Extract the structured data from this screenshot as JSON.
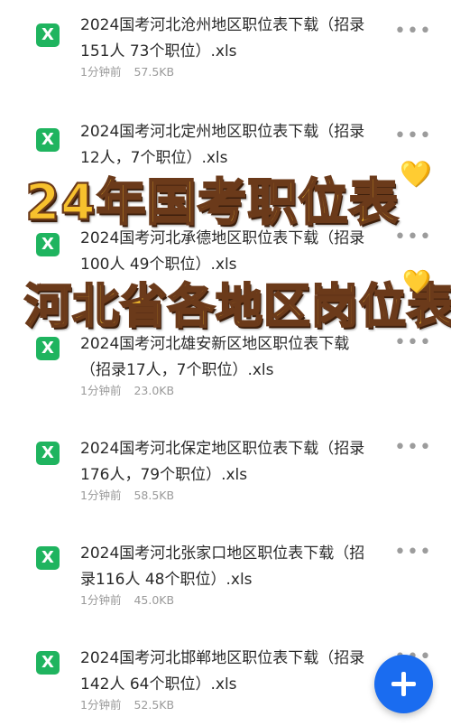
{
  "file_icon_glyph": "X",
  "more_icon_glyph": "•••",
  "colors": {
    "excel_green": "#1fb45f",
    "fab_blue": "#1a6cf0",
    "caption_fill": "#f7c12d",
    "caption_outline": "#6b3a1a"
  },
  "files": [
    {
      "name_line1": "2024国考河北沧州地区职位表下载（招录",
      "name_line2": "151人 73个职位）.xls",
      "time": "1分钟前",
      "size": "57.5KB"
    },
    {
      "name_line1": "2024国考河北定州地区职位表下载（招录",
      "name_line2": "12人，7个职位）.xls",
      "time": "",
      "size": ""
    },
    {
      "name_line1": "2024国考河北承德地区职位表下载（招录",
      "name_line2": "100人 49个职位）.xls",
      "time": "",
      "size": ""
    },
    {
      "name_line1": "2024国考河北雄安新区地区职位表下载",
      "name_line2": "（招录17人，7个职位）.xls",
      "time": "1分钟前",
      "size": "23.0KB"
    },
    {
      "name_line1": "2024国考河北保定地区职位表下载（招录",
      "name_line2": "176人，79个职位）.xls",
      "time": "1分钟前",
      "size": "58.5KB"
    },
    {
      "name_line1": "2024国考河北张家口地区职位表下载（招",
      "name_line2": "录116人 48个职位）.xls",
      "time": "1分钟前",
      "size": "45.0KB"
    },
    {
      "name_line1": "2024国考河北邯郸地区职位表下载（招录",
      "name_line2": "142人 64个职位）.xls",
      "time": "1分钟前",
      "size": "52.5KB"
    }
  ],
  "overlay": {
    "caption_1": "24年国考职位表",
    "caption_2": "河北省各地区岗位表",
    "heart_glyph": "💛"
  },
  "fab": {
    "icon": "plus-icon"
  }
}
